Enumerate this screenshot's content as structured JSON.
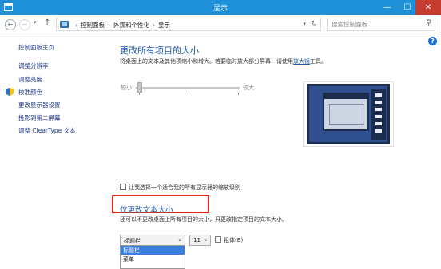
{
  "window": {
    "title": "显示",
    "controls": {
      "minimize": "—",
      "maximize": "☐",
      "close": "✕"
    }
  },
  "address_bar": {
    "back_glyph": "←",
    "forward_glyph": "→",
    "recent_glyph": "▾",
    "up_glyph": "↑",
    "breadcrumbs": [
      "控制面板",
      "外观和个性化",
      "显示"
    ],
    "separator": "›",
    "dropdown_glyph": "▾",
    "refresh_glyph": "↻",
    "search_placeholder": "搜索控制面板",
    "search_glyph": "⚲"
  },
  "help": {
    "glyph": "?"
  },
  "sidebar": {
    "home": "控制面板主页",
    "links": [
      "调整分辨率",
      "调整亮度",
      "校准颜色",
      "更改显示器设置",
      "投影到第二屏幕",
      "调整 ClearType 文本"
    ]
  },
  "main": {
    "heading": "更改所有项目的大小",
    "description": "将桌面上的文本及其他项缩小和增大。若要临时放大部分屏幕，请使用",
    "magnifier_link": "放大镜",
    "description_tail": "工具。",
    "slider": {
      "label_small": "较小",
      "label_large": "较大",
      "level": 0
    },
    "per_display_checkbox": {
      "label": "让我选择一个适合我的所有显示器的缩放级别",
      "checked": false
    },
    "text_only": {
      "heading": "仅更改文本大小",
      "description": "还可以不更改桌面上所有项目的大小，只更改指定项目的文本大小。",
      "item_select": {
        "value": "标题栏",
        "arrow": "⌄"
      },
      "size_select": {
        "value": "11",
        "arrow": "⌄"
      },
      "bold": {
        "label": "粗体(B)",
        "checked": false
      },
      "dropdown_options": [
        "标题栏",
        "菜单"
      ],
      "dropdown_selected_index": 0
    }
  },
  "colors": {
    "titlebar": "#1e90d8",
    "close_button": "#c73c31",
    "heading": "#1f5aa6",
    "highlight_frame": "#e4281e",
    "selected_option": "#3b7fde"
  }
}
